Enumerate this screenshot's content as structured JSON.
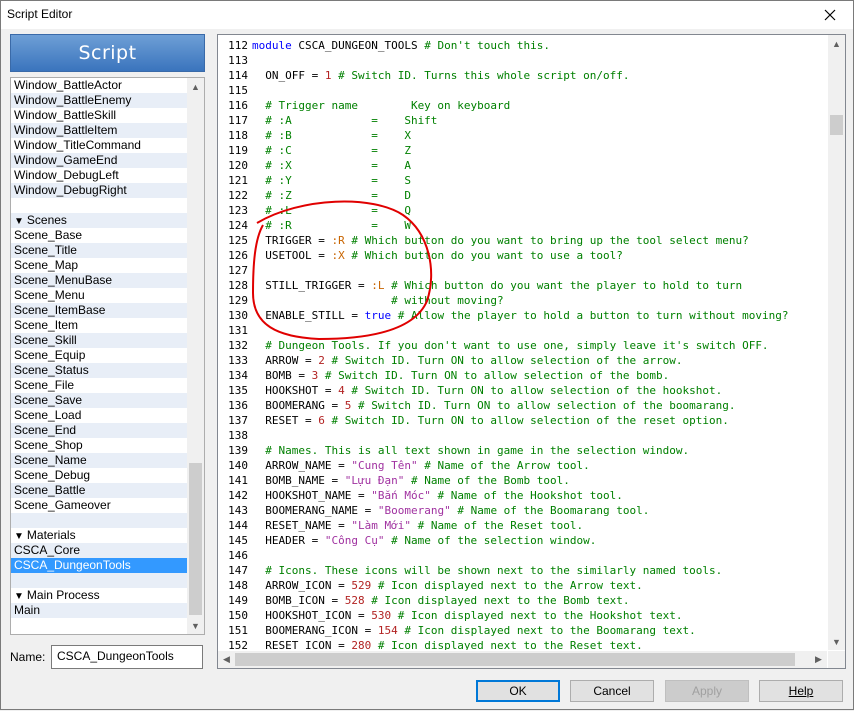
{
  "window": {
    "title": "Script Editor"
  },
  "sidebar": {
    "banner": "Script",
    "items": [
      {
        "label": "Window_BattleActor",
        "type": "item"
      },
      {
        "label": "Window_BattleEnemy",
        "type": "item"
      },
      {
        "label": "Window_BattleSkill",
        "type": "item"
      },
      {
        "label": "Window_BattleItem",
        "type": "item"
      },
      {
        "label": "Window_TitleCommand",
        "type": "item"
      },
      {
        "label": "Window_GameEnd",
        "type": "item"
      },
      {
        "label": "Window_DebugLeft",
        "type": "item"
      },
      {
        "label": "Window_DebugRight",
        "type": "item"
      },
      {
        "label": "",
        "type": "gap"
      },
      {
        "label": "Scenes",
        "type": "header"
      },
      {
        "label": "Scene_Base",
        "type": "item"
      },
      {
        "label": "Scene_Title",
        "type": "item"
      },
      {
        "label": "Scene_Map",
        "type": "item"
      },
      {
        "label": "Scene_MenuBase",
        "type": "item"
      },
      {
        "label": "Scene_Menu",
        "type": "item"
      },
      {
        "label": "Scene_ItemBase",
        "type": "item"
      },
      {
        "label": "Scene_Item",
        "type": "item"
      },
      {
        "label": "Scene_Skill",
        "type": "item"
      },
      {
        "label": "Scene_Equip",
        "type": "item"
      },
      {
        "label": "Scene_Status",
        "type": "item"
      },
      {
        "label": "Scene_File",
        "type": "item"
      },
      {
        "label": "Scene_Save",
        "type": "item"
      },
      {
        "label": "Scene_Load",
        "type": "item"
      },
      {
        "label": "Scene_End",
        "type": "item"
      },
      {
        "label": "Scene_Shop",
        "type": "item"
      },
      {
        "label": "Scene_Name",
        "type": "item"
      },
      {
        "label": "Scene_Debug",
        "type": "item"
      },
      {
        "label": "Scene_Battle",
        "type": "item"
      },
      {
        "label": "Scene_Gameover",
        "type": "item"
      },
      {
        "label": "",
        "type": "gap"
      },
      {
        "label": "Materials",
        "type": "header"
      },
      {
        "label": "CSCA_Core",
        "type": "item"
      },
      {
        "label": "CSCA_DungeonTools",
        "type": "selected"
      },
      {
        "label": "",
        "type": "gap"
      },
      {
        "label": "Main Process",
        "type": "header"
      },
      {
        "label": "Main",
        "type": "item"
      }
    ]
  },
  "name_field": {
    "label": "Name:",
    "value": "CSCA_DungeonTools"
  },
  "editor": {
    "lines": [
      {
        "n": "112",
        "parts": [
          [
            "kw",
            "module "
          ],
          [
            "",
            "CSCA_DUNGEON_TOOLS "
          ],
          [
            "cm",
            "# Don't touch this."
          ]
        ]
      },
      {
        "n": "113",
        "parts": []
      },
      {
        "n": "114",
        "parts": [
          [
            "",
            "  ON_OFF = "
          ],
          [
            "nm",
            "1"
          ],
          [
            "cm",
            " # Switch ID. Turns this whole script on/off."
          ]
        ]
      },
      {
        "n": "115",
        "parts": []
      },
      {
        "n": "116",
        "parts": [
          [
            "cm",
            "  # Trigger name        Key on keyboard"
          ]
        ]
      },
      {
        "n": "117",
        "parts": [
          [
            "cm",
            "  # :A            =    Shift"
          ]
        ]
      },
      {
        "n": "118",
        "parts": [
          [
            "cm",
            "  # :B            =    X"
          ]
        ]
      },
      {
        "n": "119",
        "parts": [
          [
            "cm",
            "  # :C            =    Z"
          ]
        ]
      },
      {
        "n": "120",
        "parts": [
          [
            "cm",
            "  # :X            =    A"
          ]
        ]
      },
      {
        "n": "121",
        "parts": [
          [
            "cm",
            "  # :Y            =    S"
          ]
        ]
      },
      {
        "n": "122",
        "parts": [
          [
            "cm",
            "  # :Z            =    D"
          ]
        ]
      },
      {
        "n": "123",
        "parts": [
          [
            "cm",
            "  # :L            =    Q"
          ]
        ]
      },
      {
        "n": "124",
        "parts": [
          [
            "cm",
            "  # :R            =    W"
          ]
        ]
      },
      {
        "n": "125",
        "parts": [
          [
            "",
            "  TRIGGER = "
          ],
          [
            "sym",
            ":R"
          ],
          [
            "cm",
            " # Which button do you want to bring up the tool select menu?"
          ]
        ]
      },
      {
        "n": "126",
        "parts": [
          [
            "",
            "  USETOOL = "
          ],
          [
            "sym",
            ":X"
          ],
          [
            "cm",
            " # Which button do you want to use a tool?"
          ]
        ]
      },
      {
        "n": "127",
        "parts": []
      },
      {
        "n": "128",
        "parts": [
          [
            "",
            "  STILL_TRIGGER = "
          ],
          [
            "sym",
            ":L"
          ],
          [
            "cm",
            " # Which button do you want the player to hold to turn"
          ]
        ]
      },
      {
        "n": "129",
        "parts": [
          [
            "cm",
            "                     # without moving?"
          ]
        ]
      },
      {
        "n": "130",
        "parts": [
          [
            "",
            "  ENABLE_STILL = "
          ],
          [
            "kw",
            "true"
          ],
          [
            "cm",
            " # Allow the player to hold a button to turn without moving?"
          ]
        ]
      },
      {
        "n": "131",
        "parts": []
      },
      {
        "n": "132",
        "parts": [
          [
            "cm",
            "  # Dungeon Tools. If you don't want to use one, simply leave it's switch OFF."
          ]
        ]
      },
      {
        "n": "133",
        "parts": [
          [
            "",
            "  ARROW = "
          ],
          [
            "nm",
            "2"
          ],
          [
            "cm",
            " # Switch ID. Turn ON to allow selection of the arrow."
          ]
        ]
      },
      {
        "n": "134",
        "parts": [
          [
            "",
            "  BOMB = "
          ],
          [
            "nm",
            "3"
          ],
          [
            "cm",
            " # Switch ID. Turn ON to allow selection of the bomb."
          ]
        ]
      },
      {
        "n": "135",
        "parts": [
          [
            "",
            "  HOOKSHOT = "
          ],
          [
            "nm",
            "4"
          ],
          [
            "cm",
            " # Switch ID. Turn ON to allow selection of the hookshot."
          ]
        ]
      },
      {
        "n": "136",
        "parts": [
          [
            "",
            "  BOOMERANG = "
          ],
          [
            "nm",
            "5"
          ],
          [
            "cm",
            " # Switch ID. Turn ON to allow selection of the boomarang."
          ]
        ]
      },
      {
        "n": "137",
        "parts": [
          [
            "",
            "  RESET = "
          ],
          [
            "nm",
            "6"
          ],
          [
            "cm",
            " # Switch ID. Turn ON to allow selection of the reset option."
          ]
        ]
      },
      {
        "n": "138",
        "parts": []
      },
      {
        "n": "139",
        "parts": [
          [
            "cm",
            "  # Names. This is all text shown in game in the selection window."
          ]
        ]
      },
      {
        "n": "140",
        "parts": [
          [
            "",
            "  ARROW_NAME = "
          ],
          [
            "str",
            "\"Cung Tên\""
          ],
          [
            "cm",
            " # Name of the Arrow tool."
          ]
        ]
      },
      {
        "n": "141",
        "parts": [
          [
            "",
            "  BOMB_NAME = "
          ],
          [
            "str",
            "\"Lựu Đạn\""
          ],
          [
            "cm",
            " # Name of the Bomb tool."
          ]
        ]
      },
      {
        "n": "142",
        "parts": [
          [
            "",
            "  HOOKSHOT_NAME = "
          ],
          [
            "str",
            "\"Bắn Móc\""
          ],
          [
            "cm",
            " # Name of the Hookshot tool."
          ]
        ]
      },
      {
        "n": "143",
        "parts": [
          [
            "",
            "  BOOMERANG_NAME = "
          ],
          [
            "str",
            "\"Boomerang\""
          ],
          [
            "cm",
            " # Name of the Boomarang tool."
          ]
        ]
      },
      {
        "n": "144",
        "parts": [
          [
            "",
            "  RESET_NAME = "
          ],
          [
            "str",
            "\"Làm Mới\""
          ],
          [
            "cm",
            " # Name of the Reset tool."
          ]
        ]
      },
      {
        "n": "145",
        "parts": [
          [
            "",
            "  HEADER = "
          ],
          [
            "str",
            "\"Công Cụ\""
          ],
          [
            "cm",
            " # Name of the selection window."
          ]
        ]
      },
      {
        "n": "146",
        "parts": []
      },
      {
        "n": "147",
        "parts": [
          [
            "cm",
            "  # Icons. These icons will be shown next to the similarly named tools."
          ]
        ]
      },
      {
        "n": "148",
        "parts": [
          [
            "",
            "  ARROW_ICON = "
          ],
          [
            "nm",
            "529"
          ],
          [
            "cm",
            " # Icon displayed next to the Arrow text."
          ]
        ]
      },
      {
        "n": "149",
        "parts": [
          [
            "",
            "  BOMB_ICON = "
          ],
          [
            "nm",
            "528"
          ],
          [
            "cm",
            " # Icon displayed next to the Bomb text."
          ]
        ]
      },
      {
        "n": "150",
        "parts": [
          [
            "",
            "  HOOKSHOT_ICON = "
          ],
          [
            "nm",
            "530"
          ],
          [
            "cm",
            " # Icon displayed next to the Hookshot text."
          ]
        ]
      },
      {
        "n": "151",
        "parts": [
          [
            "",
            "  BOOMERANG_ICON = "
          ],
          [
            "nm",
            "154"
          ],
          [
            "cm",
            " # Icon displayed next to the Boomarang text."
          ]
        ]
      },
      {
        "n": "152",
        "parts": [
          [
            "",
            "  RESET_ICON = "
          ],
          [
            "nm",
            "280"
          ],
          [
            "cm",
            " # Icon displayed next to the Reset text."
          ]
        ]
      }
    ]
  },
  "buttons": {
    "ok": "OK",
    "cancel": "Cancel",
    "apply": "Apply",
    "help": "Help"
  },
  "colors": {
    "keyword": "#0000ff",
    "comment": "#008000",
    "number": "#b22222",
    "symbol": "#c86400",
    "string": "#a031a0",
    "selection": "#3399ff",
    "annotation": "#e00000"
  }
}
